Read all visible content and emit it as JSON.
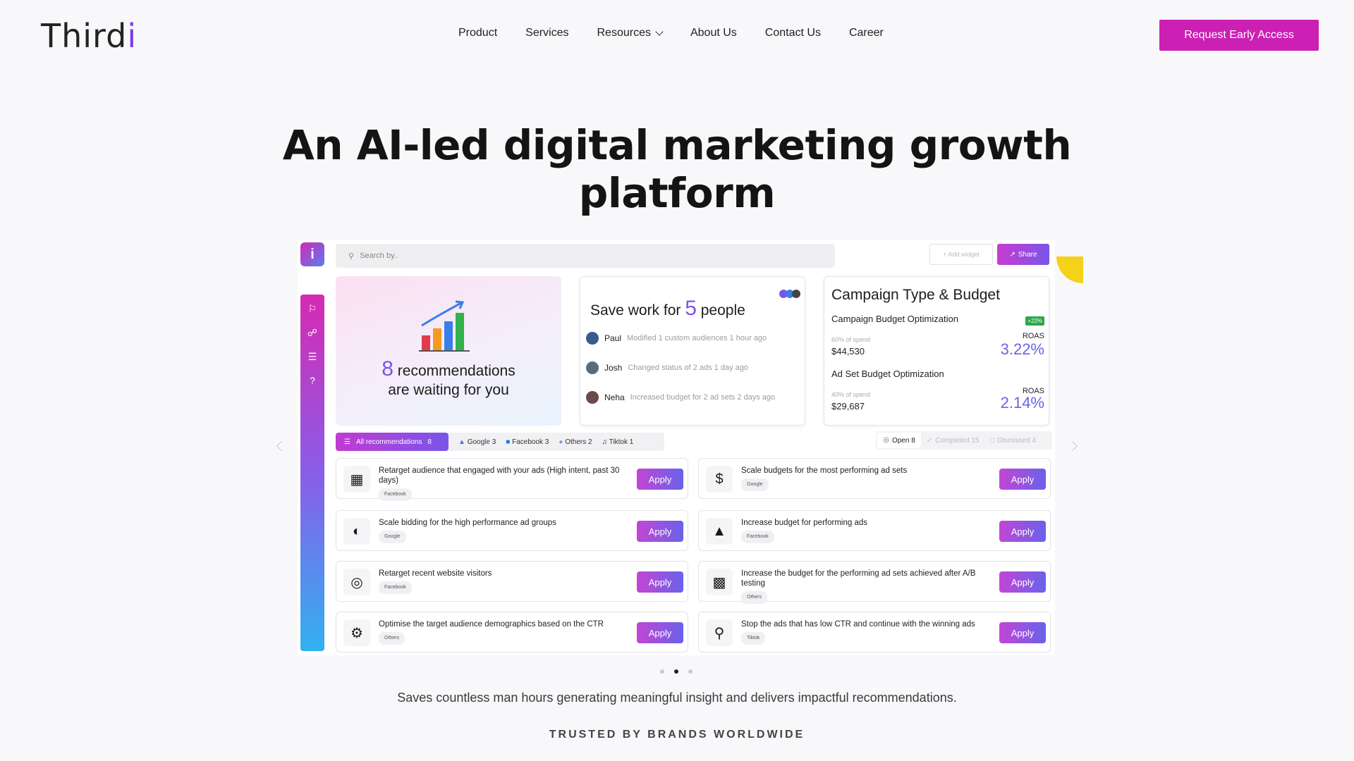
{
  "header": {
    "logo": "Third",
    "logo_accent": "i",
    "nav": [
      "Product",
      "Services",
      "Resources",
      "About Us",
      "Contact Us",
      "Career"
    ],
    "cta": "Request Early Access"
  },
  "hero": {
    "title": "An AI-led digital marketing growth platform"
  },
  "dashboard": {
    "search_placeholder": "Search by..",
    "add_widget": "+ Add widget",
    "share": "Share",
    "recommend_card": {
      "count": "8",
      "line1": " recommendations",
      "line2": "are waiting for you"
    },
    "save_card": {
      "title_pre": "Save work for ",
      "count": "5",
      "title_post": " people",
      "activities": [
        {
          "name": "Paul",
          "text": "Modified 1 custom audiences 1 hour ago"
        },
        {
          "name": "Josh",
          "text": "Changed status of 2 ads 1 day ago"
        },
        {
          "name": "Neha",
          "text": "Increased budget for 2 ad sets 2 days ago"
        }
      ]
    },
    "campaign_card": {
      "title": "Campaign Type & Budget",
      "badge": "+22%",
      "items": [
        {
          "label": "Campaign Budget Optimization",
          "spend_note": "60% of spend",
          "spend": "$44,530",
          "roas_label": "ROAS",
          "roas": "3.22%"
        },
        {
          "label": "Ad Set Budget Optimization",
          "spend_note": "40% of spend",
          "spend": "$29,687",
          "roas_label": "ROAS",
          "roas": "2.14%"
        }
      ]
    },
    "filters": {
      "all": "All recommendations",
      "all_count": "8",
      "platforms": [
        "Google 3",
        "Facebook 3",
        "Others 2",
        "Tiktok 1"
      ],
      "status": [
        "Open 8",
        "Completed 15",
        "Dismissed 4"
      ]
    },
    "apply_label": "Apply",
    "recommendations": [
      {
        "text": "Retarget audience that engaged with your ads (High intent, past 30 days)",
        "tag": "Facebook",
        "icon": "browser-icon"
      },
      {
        "text": "Scale budgets for the most performing ad sets",
        "tag": "Google",
        "icon": "money-stack-icon"
      },
      {
        "text": "Scale bidding for the high performance ad groups",
        "tag": "Google",
        "icon": "gauge-icon"
      },
      {
        "text": "Increase budget for performing ads",
        "tag": "Facebook",
        "icon": "growth-chart-icon"
      },
      {
        "text": "Retarget recent website visitors",
        "tag": "Facebook",
        "icon": "target-user-icon"
      },
      {
        "text": "Increase the budget for the performing ad sets achieved after A/B testing",
        "tag": "Others",
        "icon": "ab-test-icon"
      },
      {
        "text": "Optimise the target audience demographics based on the CTR",
        "tag": "Others",
        "icon": "gears-icon"
      },
      {
        "text": "Stop the ads that has low CTR and continue with the winning ads",
        "tag": "Tiktok",
        "icon": "magnifier-icon"
      }
    ]
  },
  "tagline": "Saves countless man hours generating meaningful insight and delivers impactful recommendations.",
  "trusted": "TRUSTED BY BRANDS WORLDWIDE",
  "colors": {
    "accent": "#cc1fb3",
    "purple": "#7b55e8"
  }
}
